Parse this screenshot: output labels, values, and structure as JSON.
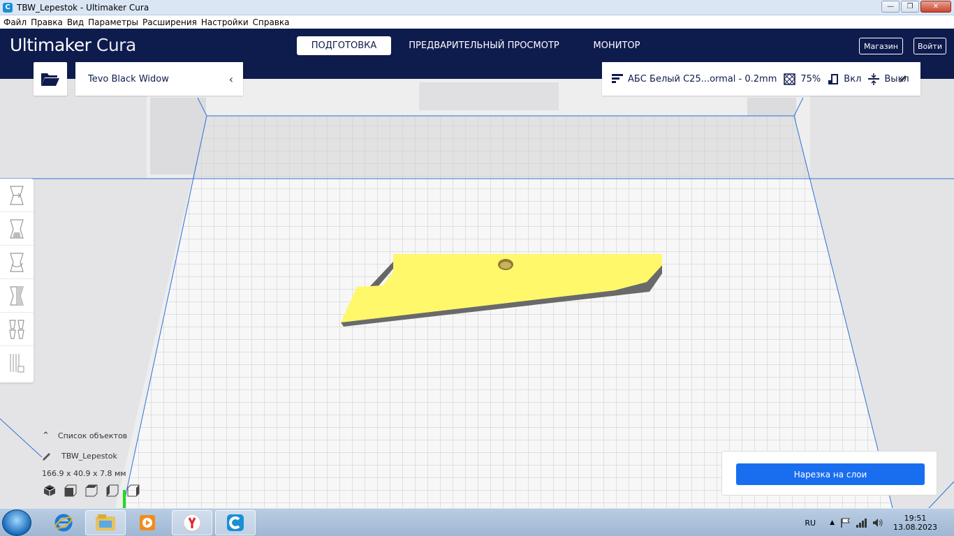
{
  "window": {
    "title": "TBW_Lepestok - Ultimaker Cura",
    "icon": "cura-icon"
  },
  "menu": [
    "Файл",
    "Правка",
    "Вид",
    "Параметры",
    "Расширения",
    "Настройки",
    "Справка"
  ],
  "header": {
    "logo_bold": "Ultimaker",
    "logo_light": "Cura",
    "tabs": [
      "ПОДГОТОВКА",
      "ПРЕДВАРИТЕЛЬНЫЙ ПРОСМОТР",
      "МОНИТОР"
    ],
    "active_tab": "ПОДГОТОВКА",
    "marketplace": "Магазин",
    "signin": "Войти"
  },
  "printer": {
    "name": "Tevo Black Widow"
  },
  "print_setup": {
    "profile": "АБС Белый С25...ormal - 0.2mm",
    "infill": "75%",
    "support": "Вкл",
    "adhesion": "Выкл"
  },
  "tools": [
    "move-tool-icon",
    "scale-tool-icon",
    "rotate-tool-icon",
    "mirror-tool-icon",
    "per-model-settings-icon",
    "support-blocker-icon"
  ],
  "object_list": {
    "header": "Список объектов",
    "object_name": "TBW_Lepestok",
    "dimensions": "166.9 x 40.9 x 7.8 мм"
  },
  "slice": {
    "button": "Нарезка на слои"
  },
  "colors": {
    "header_bg": "#0e1b4d",
    "accent": "#196ef0",
    "model": "#fff86a"
  },
  "taskbar": {
    "apps": [
      "ie-icon",
      "explorer-icon",
      "media-player-icon",
      "yandex-browser-icon",
      "cura-icon"
    ],
    "language": "RU",
    "time": "19:51",
    "date": "13.08.2023"
  }
}
